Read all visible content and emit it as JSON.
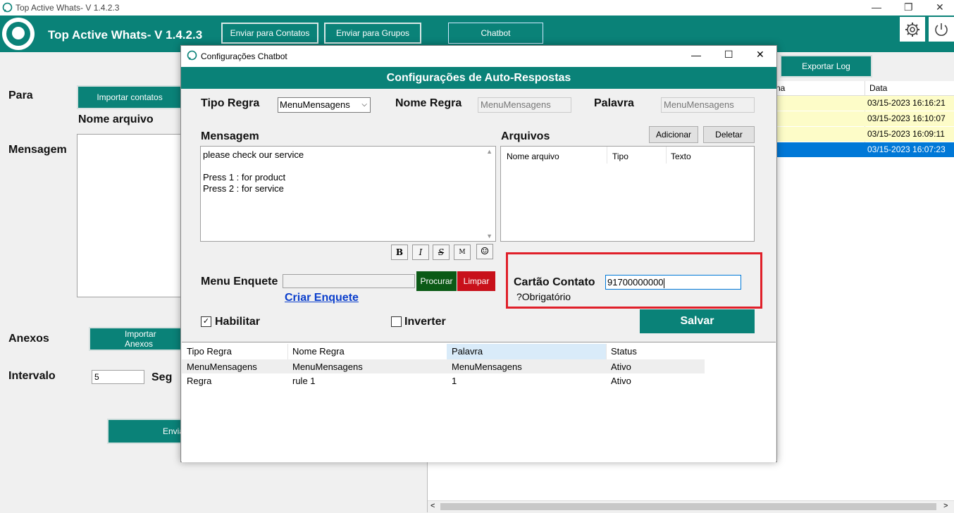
{
  "app": {
    "window_title": "Top Active Whats- V 1.4.2.3",
    "brand_title": "Top Active Whats- V 1.4.2.3",
    "nav": [
      "Enviar para Contatos",
      "Enviar para Grupos",
      "Chatbot"
    ],
    "export_log": "Exportar Log"
  },
  "form": {
    "para_label": "Para",
    "import_contacts": "Importar contatos",
    "nome_arquivo": "Nome arquivo",
    "mensagem_label": "Mensagem",
    "anexos_label": "Anexos",
    "import_anexos": "Importar Anexos",
    "intervalo_label": "Intervalo",
    "intervalo_value": "5",
    "seg_label": "Seg",
    "enviar_partial": "Envia"
  },
  "log": {
    "col_name_partial": "na",
    "col_date": "Data",
    "rows": [
      "03/15-2023 16:16:21",
      "03/15-2023 16:10:07",
      "03/15-2023 16:09:11",
      "03/15-2023 16:07:23"
    ],
    "row_colors": [
      "#fdfcc8",
      "#fdfcc8",
      "#fdfcc8",
      "#0078d7"
    ]
  },
  "dialog": {
    "title": "Configurações Chatbot",
    "header": "Configurações de Auto-Respostas",
    "tipo_regra_label": "Tipo Regra",
    "tipo_regra_value": "MenuMensagens",
    "nome_regra_label": "Nome Regra",
    "nome_regra_value": "MenuMensagens",
    "palavra_label": "Palavra",
    "palavra_value": "MenuMensagens",
    "mensagem_label": "Mensagem",
    "mensagem_lines": [
      "please check our service",
      "",
      "Press 1 : for product",
      "Press 2 : for service"
    ],
    "arquivos_label": "Arquivos",
    "adicionar": "Adicionar",
    "deletar": "Deletar",
    "arquivos_cols": [
      "Nome arquivo",
      "Tipo",
      "Texto"
    ],
    "format_buttons": [
      "B",
      "I",
      "S",
      "M",
      "☺"
    ],
    "menu_enquete_label": "Menu Enquete",
    "menu_enquete_value": "",
    "procurar": "Procurar",
    "limpar": "Limpar",
    "criar_enquete": "Criar Enquete",
    "cartao_label": "Cartão Contato",
    "cartao_value": "91700000000",
    "obrigatorio": "?Obrigatório",
    "habilitar_label": "Habilitar",
    "habilitar_checked": true,
    "inverter_label": "Inverter",
    "inverter_checked": false,
    "salvar": "Salvar",
    "grid": {
      "headers": [
        "Tipo Regra",
        "Nome Regra",
        "Palavra",
        "Status"
      ],
      "rows": [
        [
          "MenuMensagens",
          "MenuMensagens",
          "MenuMensagens",
          "Ativo"
        ],
        [
          "Regra",
          "rule 1",
          "1",
          "Ativo"
        ]
      ]
    },
    "accent": "#0a8278",
    "highlight_border": "#e0202a"
  }
}
